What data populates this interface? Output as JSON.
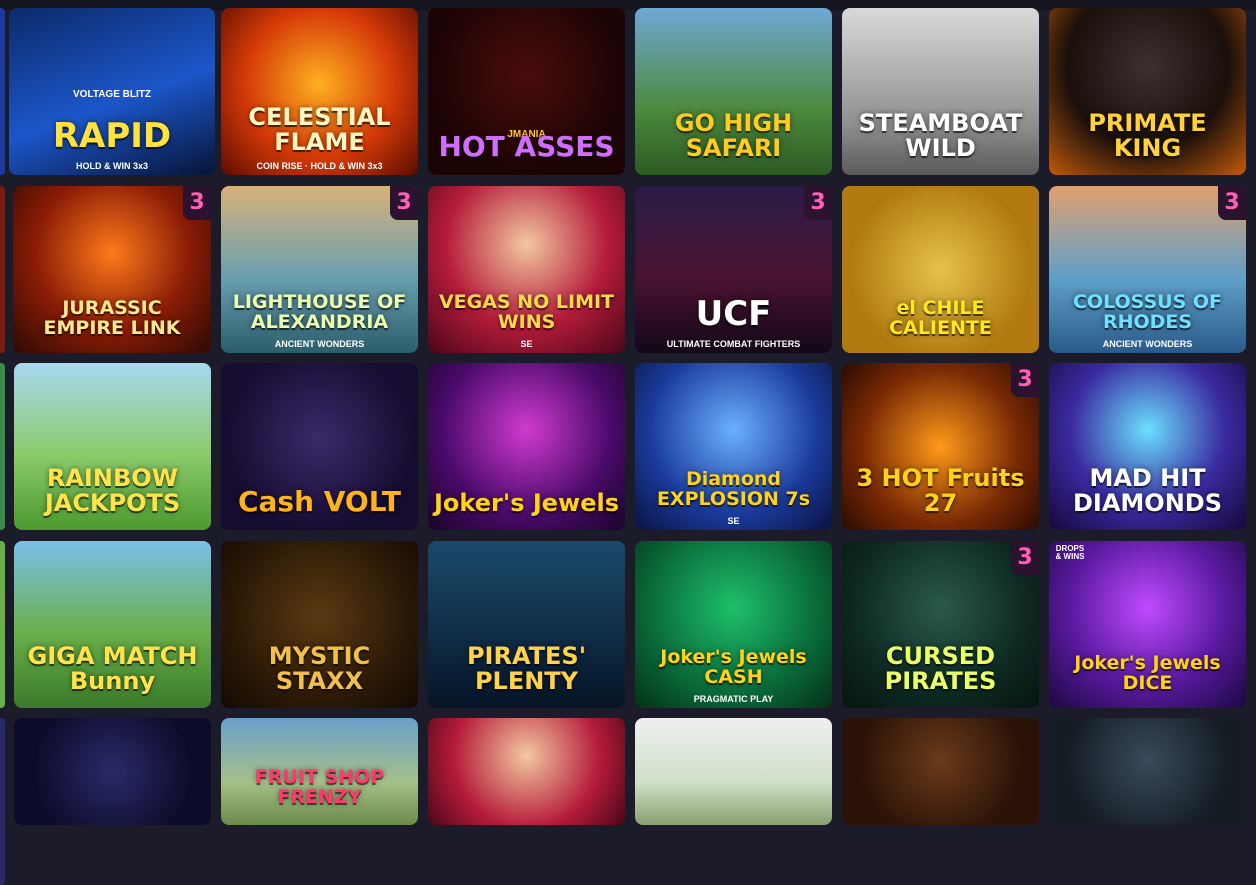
{
  "games": [
    {
      "title": "RAPID",
      "subtitle": "HOLD & WIN 3x3",
      "brand": "VOLTAGE BLITZ",
      "bg": "linear-gradient(160deg,#0b2a6a,#1c56c9 55%,#061438)",
      "color": "#ffe23d",
      "badge": ""
    },
    {
      "title": "CELESTIAL FLAME",
      "subtitle": "COIN RISE · HOLD & WIN 3x3",
      "brand": "",
      "bg": "radial-gradient(circle at 50% 45%,#ffb020,#d53a08 55%,#5a0c02)",
      "color": "#fff6c2",
      "badge": ""
    },
    {
      "title": "HOT ASSES",
      "subtitle": "",
      "brand": "JMANIA",
      "bg": "radial-gradient(circle at 50% 40%,#4a0c0c,#1c0404 70%)",
      "color": "#d06cff",
      "badge": ""
    },
    {
      "title": "GO HIGH SAFARI",
      "subtitle": "",
      "brand": "",
      "bg": "linear-gradient(180deg,#6fa8d6,#4d8a3e 60%,#2c5a23)",
      "color": "#ffcb1f",
      "badge": ""
    },
    {
      "title": "STEAMBOAT WILD",
      "subtitle": "",
      "brand": "",
      "bg": "linear-gradient(180deg,#d9d9d9,#8f8f8f 70%,#5a5a5a)",
      "color": "#ffffff",
      "badge": ""
    },
    {
      "title": "PRIMATE KING",
      "subtitle": "",
      "brand": "",
      "bg": "radial-gradient(circle at 50% 35%,#3d3030,#1a0f0a 55%,#c25a0c)",
      "color": "#ffd13a",
      "badge": ""
    },
    {
      "title": "JURASSIC EMPIRE LINK",
      "subtitle": "",
      "brand": "",
      "bg": "radial-gradient(circle at 50% 40%,#ff7a1a,#8a1c06 55%,#2a0903)",
      "color": "#ffe890",
      "badge": "3"
    },
    {
      "title": "LIGHTHOUSE OF ALEXANDRIA",
      "subtitle": "ANCIENT WONDERS",
      "brand": "",
      "bg": "linear-gradient(180deg,#d6b27a,#6a9fb0 55%,#2b5d6a)",
      "color": "#eaffb0",
      "badge": "3"
    },
    {
      "title": "VEGAS NO LIMIT WINS",
      "subtitle": "SE",
      "brand": "",
      "bg": "radial-gradient(circle at 50% 35%,#f3c8a0,#b51c3a 55%,#4a061a)",
      "color": "#ffd84a",
      "badge": ""
    },
    {
      "title": "UCF",
      "subtitle": "ULTIMATE COMBAT FIGHTERS",
      "brand": "",
      "bg": "linear-gradient(180deg,#2a1c48,#4a1230 55%,#120818)",
      "color": "#ffffff",
      "badge": "3"
    },
    {
      "title": "el CHILE CALIENTE",
      "subtitle": "",
      "brand": "",
      "bg": "radial-gradient(circle at 50% 50%,#e6c24a,#b07a10 70%)",
      "color": "#ffe81a",
      "badge": ""
    },
    {
      "title": "COLOSSUS OF RHODES",
      "subtitle": "ANCIENT WONDERS",
      "brand": "",
      "bg": "linear-gradient(180deg,#e0a070,#5fa0c8 55%,#2a5a8a)",
      "color": "#6fe0ff",
      "badge": "3"
    },
    {
      "title": "RAINBOW JACKPOTS",
      "subtitle": "",
      "brand": "",
      "bg": "linear-gradient(180deg,#a8d8f0,#8acb6a 55%,#4c9a2e)",
      "color": "#ffe34a",
      "badge": ""
    },
    {
      "title": "Cash VOLT",
      "subtitle": "",
      "brand": "",
      "bg": "radial-gradient(circle at 50% 45%,#3a2a6a,#160c30 70%)",
      "color": "#ffb21a",
      "badge": ""
    },
    {
      "title": "Joker's Jewels",
      "subtitle": "",
      "brand": "",
      "bg": "radial-gradient(circle at 50% 40%,#d03ad0,#4a0a6a 60%,#1a0428)",
      "color": "#ffd21a",
      "badge": ""
    },
    {
      "title": "Diamond EXPLOSION 7s",
      "subtitle": "SE",
      "brand": "",
      "bg": "radial-gradient(circle at 50% 40%,#6ab0ff,#1a3a9a 60%,#0a1240)",
      "color": "#ffd21a",
      "badge": ""
    },
    {
      "title": "3 HOT Fruits 27",
      "subtitle": "",
      "brand": "",
      "bg": "radial-gradient(circle at 50% 50%,#ff9a1a,#7a2a04 60%,#2a0a02)",
      "color": "#ffd21a",
      "badge": "3"
    },
    {
      "title": "MAD HIT DIAMONDS",
      "subtitle": "",
      "brand": "",
      "bg": "radial-gradient(circle at 50% 40%,#6ae0ff,#3a2aa0 55%,#16083a)",
      "color": "#ffffff",
      "badge": ""
    },
    {
      "title": "GIGA MATCH Bunny",
      "subtitle": "",
      "brand": "",
      "bg": "linear-gradient(180deg,#7ac0ea,#6ab04a 55%,#3a7a2a)",
      "color": "#ffe34a",
      "badge": ""
    },
    {
      "title": "MYSTIC STAXX",
      "subtitle": "",
      "brand": "",
      "bg": "radial-gradient(circle at 50% 45%,#5a3a12,#2a1806 65%,#120a02)",
      "color": "#f0c04a",
      "badge": ""
    },
    {
      "title": "PIRATES' PLENTY",
      "subtitle": "",
      "brand": "",
      "bg": "linear-gradient(180deg,#1a4a6a,#0e2a44 60%,#061426)",
      "color": "#ffd24a",
      "badge": ""
    },
    {
      "title": "Joker's Jewels CASH",
      "subtitle": "PRAGMATIC PLAY",
      "brand": "",
      "bg": "radial-gradient(circle at 50% 40%,#1ec06a,#0a6a3a 60%,#043018)",
      "color": "#ffd21a",
      "badge": ""
    },
    {
      "title": "CURSED PIRATES",
      "subtitle": "",
      "brand": "",
      "bg": "radial-gradient(circle at 50% 40%,#2a5a4a,#0e2a22 60%,#061410)",
      "color": "#eaff6a",
      "badge": "3"
    },
    {
      "title": "Joker's Jewels DICE",
      "subtitle": "",
      "brand": "DROPS & WINS",
      "bg": "radial-gradient(circle at 50% 40%,#c04aff,#5a1aa0 55%,#1a0840)",
      "color": "#ffd21a",
      "badge": ""
    },
    {
      "title": "",
      "subtitle": "",
      "brand": "",
      "bg": "radial-gradient(circle at 50% 50%,#2a2a6a,#0c0c2a 70%)",
      "color": "#ffffff",
      "badge": ""
    },
    {
      "title": "FRUIT SHOP FRENZY",
      "subtitle": "",
      "brand": "",
      "bg": "linear-gradient(180deg,#6aa0c8,#a6c08a 60%,#6a8a4a)",
      "color": "#ff3a6a",
      "badge": ""
    },
    {
      "title": "",
      "subtitle": "",
      "brand": "",
      "bg": "radial-gradient(circle at 50% 35%,#f3c8a0,#b51c3a 60%,#4a061a)",
      "color": "#ffffff",
      "badge": ""
    },
    {
      "title": "",
      "subtitle": "",
      "brand": "",
      "bg": "linear-gradient(180deg,#f0f0f0,#cfe0c8 60%,#8aa070)",
      "color": "#ffffff",
      "badge": ""
    },
    {
      "title": "",
      "subtitle": "",
      "brand": "",
      "bg": "radial-gradient(circle at 50% 40%,#6a3a1a,#2a1206 70%)",
      "color": "#ffffff",
      "badge": ""
    },
    {
      "title": "",
      "subtitle": "",
      "brand": "",
      "bg": "radial-gradient(circle at 50% 40%,#3a4a5a,#141c24 70%)",
      "color": "#ffffff",
      "badge": ""
    }
  ]
}
